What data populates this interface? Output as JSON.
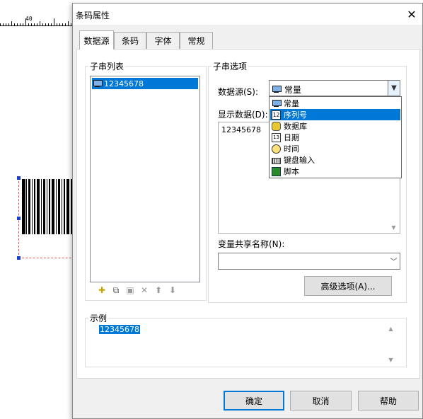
{
  "background": {
    "ruler_label": "40"
  },
  "dialog": {
    "title": "条码属性",
    "close_icon": "close-icon",
    "tabs": [
      {
        "label": "数据源",
        "active": true
      },
      {
        "label": "条码",
        "active": false
      },
      {
        "label": "字体",
        "active": false
      },
      {
        "label": "常规",
        "active": false
      }
    ],
    "substring_list": {
      "legend": "子串列表",
      "items": [
        {
          "label": "12345678",
          "icon": "computer-icon",
          "selected": true
        }
      ],
      "toolbar_icons": [
        "add-icon",
        "copy-icon",
        "paste-icon",
        "delete-icon",
        "move-up-icon",
        "move-down-icon"
      ]
    },
    "substring_options": {
      "legend": "子串选项",
      "datasource_label": "数据源(S):",
      "datasource_value": "常量",
      "datasource_options": [
        {
          "label": "常量",
          "icon": "computer-icon",
          "selected": false
        },
        {
          "label": "序列号",
          "icon": "serial-number-icon",
          "selected": true
        },
        {
          "label": "数据库",
          "icon": "database-icon",
          "selected": false
        },
        {
          "label": "日期",
          "icon": "calendar-icon",
          "selected": false
        },
        {
          "label": "时间",
          "icon": "clock-icon",
          "selected": false
        },
        {
          "label": "键盘输入",
          "icon": "keyboard-icon",
          "selected": false
        },
        {
          "label": "脚本",
          "icon": "script-icon",
          "selected": false
        }
      ],
      "display_data_label": "显示数据(D):",
      "display_data_value": "12345678",
      "shared_var_label": "变量共享名称(N):",
      "shared_var_value": "",
      "advanced_button": "高级选项(A)..."
    },
    "example": {
      "legend": "示例",
      "value": "12345678"
    },
    "buttons": {
      "ok": "确定",
      "cancel": "取消",
      "help": "帮助"
    },
    "colors": {
      "selection": "#0078d7",
      "default_button_border": "#0078d7",
      "handle": "#1a3cd0"
    }
  }
}
